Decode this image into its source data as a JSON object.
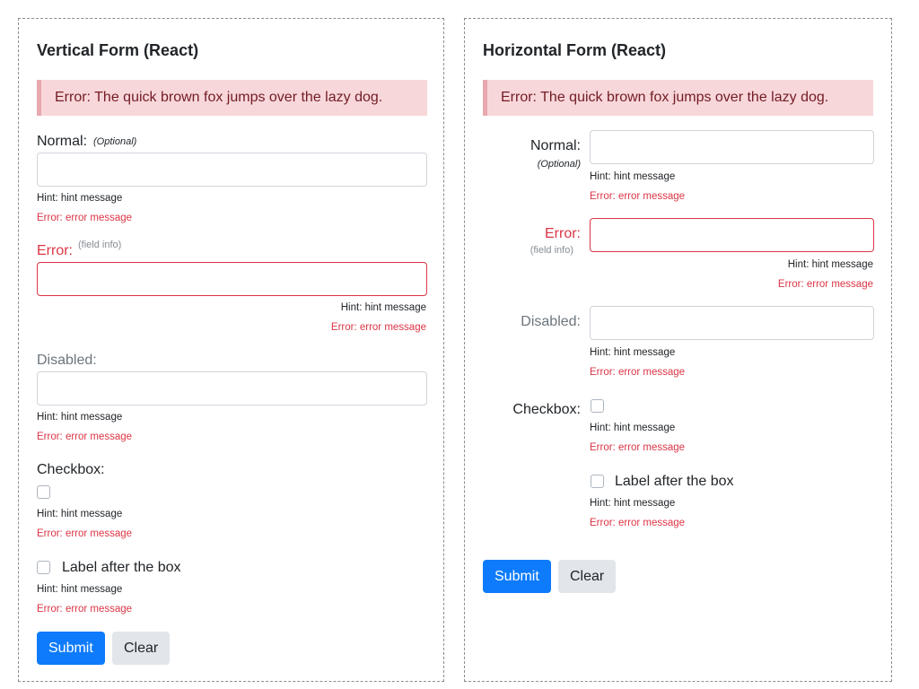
{
  "vertical": {
    "title": "Vertical Form (React)",
    "alert": "Error: The quick brown fox jumps over the lazy dog.",
    "normal": {
      "label": "Normal:",
      "optional": "(Optional)",
      "hint": "Hint: hint message",
      "error": "Error: error message"
    },
    "error_field": {
      "label": "Error:",
      "info": "(field info)",
      "hint": "Hint: hint message",
      "error": "Error: error message"
    },
    "disabled": {
      "label": "Disabled:",
      "hint": "Hint: hint message",
      "error": "Error: error message"
    },
    "checkbox": {
      "label": "Checkbox:",
      "hint": "Hint: hint message",
      "error": "Error: error message"
    },
    "checkbox_after": {
      "label": "Label after the box",
      "hint": "Hint: hint message",
      "error": "Error: error message"
    },
    "submit": "Submit",
    "clear": "Clear"
  },
  "horizontal": {
    "title": "Horizontal Form (React)",
    "alert": "Error: The quick brown fox jumps over the lazy dog.",
    "normal": {
      "label": "Normal:",
      "optional": "(Optional)",
      "hint": "Hint: hint message",
      "error": "Error: error message"
    },
    "error_field": {
      "label": "Error:",
      "info": "(field info)",
      "hint": "Hint: hint message",
      "error": "Error: error message"
    },
    "disabled": {
      "label": "Disabled:",
      "hint": "Hint: hint message",
      "error": "Error: error message"
    },
    "checkbox": {
      "label": "Checkbox:",
      "hint": "Hint: hint message",
      "error": "Error: error message"
    },
    "checkbox_after": {
      "label": "Label after the box",
      "hint": "Hint: hint message",
      "error": "Error: error message"
    },
    "submit": "Submit",
    "clear": "Clear"
  },
  "colors": {
    "primary": "#0d7bfb",
    "danger": "#dc3545",
    "alert_bg": "#f8d7da",
    "alert_text": "#721c24"
  }
}
